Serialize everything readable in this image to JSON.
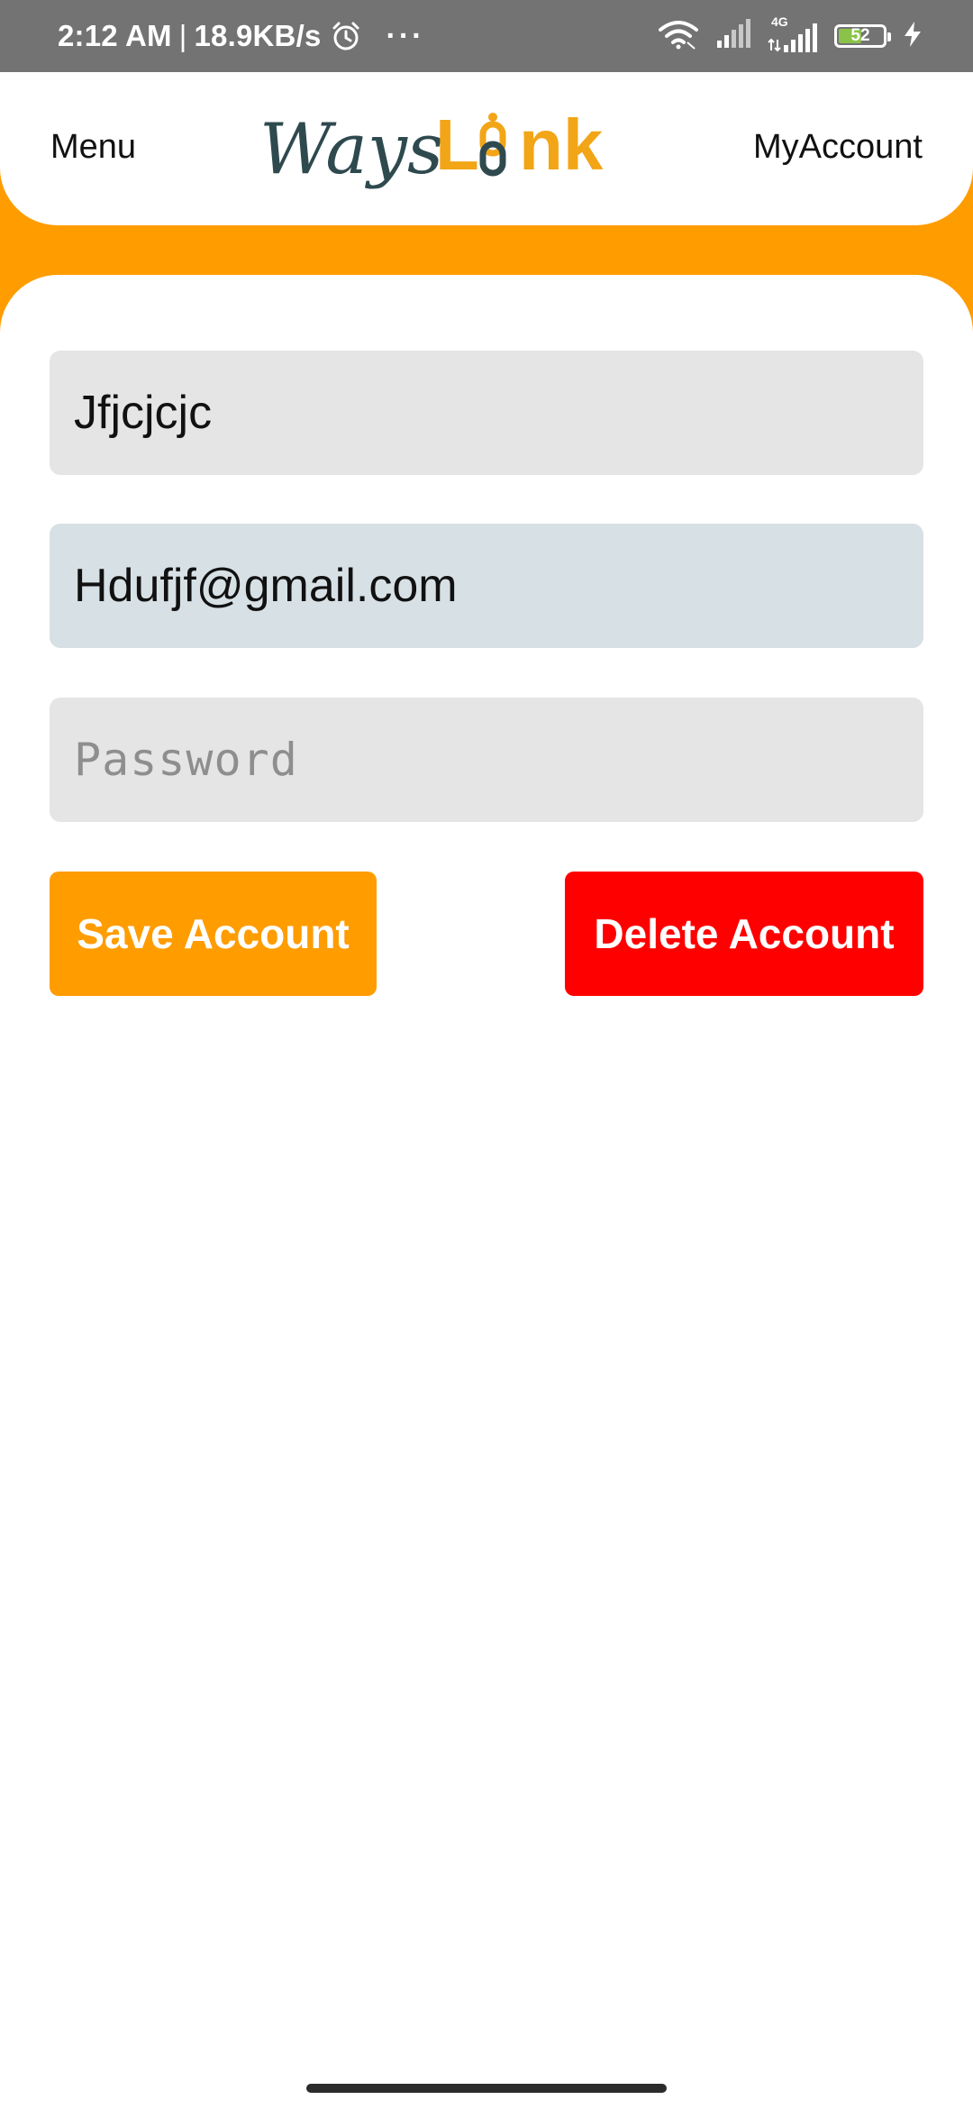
{
  "status_bar": {
    "time": "2:12 AM",
    "separator": "|",
    "network_speed": "18.9KB/s",
    "alarm_icon": "alarm-clock-icon",
    "more_indicator": "···",
    "network_type": "4G",
    "battery_level": "52",
    "battery_fraction": 0.52,
    "battery_fill_color": "#8bc34a"
  },
  "header": {
    "menu_label": "Menu",
    "account_label": "MyAccount",
    "logo": {
      "part1": "Ways",
      "part2_a": "L",
      "part2_b": "nk",
      "part1_color": "#2f4a4f",
      "part2_color": "#f2a516"
    }
  },
  "form": {
    "name_value": "Jfjcjcjc",
    "email_value": "Hdufjf@gmail.com",
    "password_placeholder": "Password",
    "password_value": ""
  },
  "actions": {
    "save_label": "Save Account",
    "delete_label": "Delete Account"
  },
  "colors": {
    "accent": "#ff9c00",
    "danger": "#ff0000",
    "status_bar": "#737373"
  }
}
